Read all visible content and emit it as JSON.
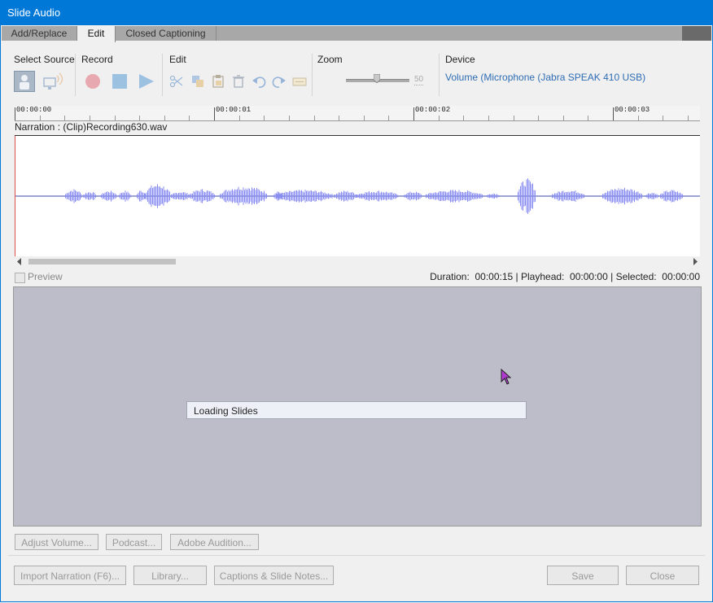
{
  "window": {
    "title": "Slide Audio"
  },
  "tabs": [
    {
      "label": "Add/Replace",
      "active": false
    },
    {
      "label": "Edit",
      "active": true
    },
    {
      "label": "Closed Captioning",
      "active": false
    }
  ],
  "toolbar": {
    "select_source_label": "Select Source",
    "record_label": "Record",
    "edit_label": "Edit",
    "zoom_label": "Zoom",
    "zoom_value": "50",
    "zoom_level_fraction": 0.5,
    "device_label": "Device",
    "device_value": "Volume (Microphone (Jabra SPEAK 410 USB)"
  },
  "timeline": {
    "ticks": [
      "00:00:00",
      "00:00:01",
      "00:00:02",
      "00:00:03"
    ],
    "track_label": "Narration : (Clip)Recording630.wav"
  },
  "preview": {
    "checkbox_label": "Preview",
    "duration_label": "Duration:",
    "duration_value": "00:00:15",
    "playhead_label": "Playhead:",
    "playhead_value": "00:00:00",
    "selected_label": "Selected:",
    "selected_value": "00:00:00"
  },
  "stage": {
    "loading_text": "Loading Slides"
  },
  "buttons": {
    "adjust_volume": "Adjust Volume...",
    "podcast": "Podcast...",
    "adobe_audition": "Adobe Audition...",
    "import_narration": "Import Narration (F6)...",
    "library": "Library...",
    "captions_notes": "Captions & Slide Notes...",
    "save": "Save",
    "close": "Close"
  },
  "colors": {
    "titlebar": "#0078d7",
    "waveform": "#8a8ef2",
    "record": "#e0707a",
    "transport": "#5b9bd5",
    "link": "#2e6db4"
  }
}
